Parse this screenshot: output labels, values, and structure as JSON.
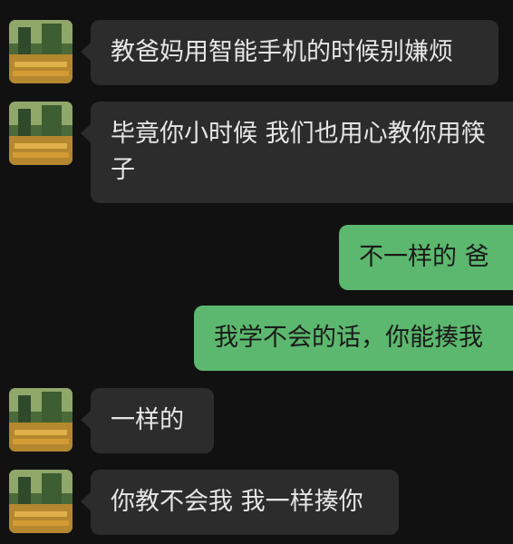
{
  "messages": [
    {
      "side": "in",
      "text": "教爸妈用智能手机的时候别嫌烦",
      "avatar": "landscape-avatar-icon"
    },
    {
      "side": "in",
      "text": "毕竟你小时候 我们也用心教你用筷子",
      "avatar": "landscape-avatar-icon"
    },
    {
      "side": "out",
      "text": "不一样的 爸"
    },
    {
      "side": "out",
      "text": "我学不会的话，你能揍我"
    },
    {
      "side": "in",
      "text": "一样的",
      "avatar": "landscape-avatar-icon"
    },
    {
      "side": "in",
      "text": "你教不会我 我一样揍你",
      "avatar": "landscape-avatar-icon"
    }
  ],
  "colors": {
    "background": "#111111",
    "incoming_bubble": "#2c2c2c",
    "outgoing_bubble": "#5cb86e"
  }
}
